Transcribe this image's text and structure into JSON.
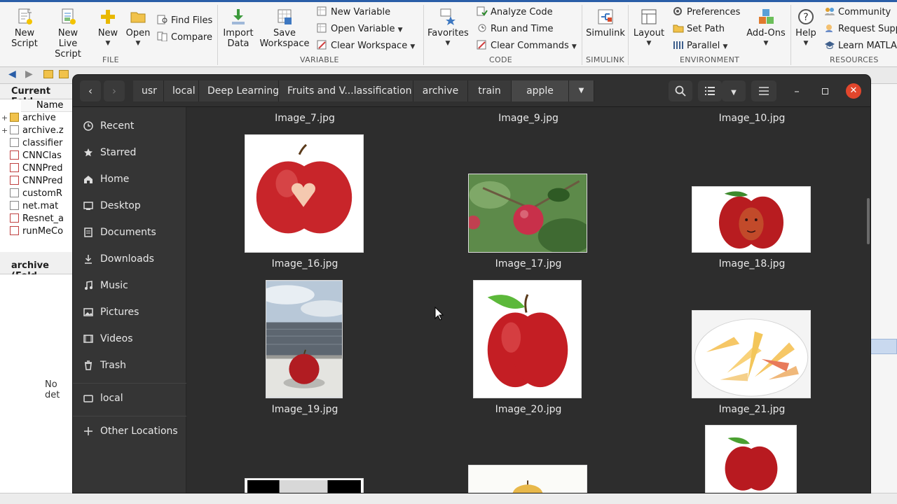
{
  "toolstrip": {
    "file": {
      "new_script": "New\nScript",
      "new_live_script": "New\nLive Script",
      "new": "New",
      "open": "Open",
      "find_files": "Find Files",
      "compare": "Compare",
      "section": "FILE"
    },
    "variable": {
      "import_data": "Import\nData",
      "save_workspace": "Save\nWorkspace",
      "new_variable": "New Variable",
      "open_variable": "Open Variable",
      "clear_workspace": "Clear Workspace",
      "section": "VARIABLE"
    },
    "code": {
      "favorites": "Favorites",
      "analyze_code": "Analyze Code",
      "run_and_time": "Run and Time",
      "clear_commands": "Clear Commands",
      "section": "CODE"
    },
    "simulink": {
      "label": "Simulink",
      "section": "SIMULINK"
    },
    "environment": {
      "layout": "Layout",
      "preferences": "Preferences",
      "set_path": "Set Path",
      "parallel": "Parallel",
      "add_ons": "Add-Ons",
      "section": "ENVIRONMENT"
    },
    "resources": {
      "help": "Help",
      "community": "Community",
      "request_support": "Request Supp",
      "learn_matlab": "Learn MATLAB",
      "section": "RESOURCES"
    }
  },
  "current_folder": {
    "title": "Current Fold",
    "column_name": "Name",
    "items": [
      {
        "name": "archive",
        "icon": "folder-icon"
      },
      {
        "name": "archive.z",
        "icon": "zip-file-icon"
      },
      {
        "name": "classifier",
        "icon": "file-icon"
      },
      {
        "name": "CNNClas",
        "icon": "mlx-file-icon"
      },
      {
        "name": "CNNPred",
        "icon": "mlx-file-icon"
      },
      {
        "name": "CNNPred",
        "icon": "mlx-file-icon"
      },
      {
        "name": "customR",
        "icon": "m-file-icon"
      },
      {
        "name": "net.mat",
        "icon": "mat-file-icon"
      },
      {
        "name": "Resnet_a",
        "icon": "mlx-file-icon"
      },
      {
        "name": "runMeCo",
        "icon": "mlx-file-icon"
      }
    ],
    "details_title": "archive  (Fold",
    "details_text": "No det"
  },
  "file_manager": {
    "breadcrumbs": [
      "usr",
      "local",
      "Deep Learning",
      "Fruits and V...lassification",
      "archive",
      "train",
      "apple"
    ],
    "sidebar": [
      {
        "label": "Recent",
        "icon": "clock-icon"
      },
      {
        "label": "Starred",
        "icon": "star-icon"
      },
      {
        "label": "Home",
        "icon": "home-icon"
      },
      {
        "label": "Desktop",
        "icon": "desktop-icon"
      },
      {
        "label": "Documents",
        "icon": "documents-icon"
      },
      {
        "label": "Downloads",
        "icon": "download-icon"
      },
      {
        "label": "Music",
        "icon": "music-icon"
      },
      {
        "label": "Pictures",
        "icon": "pictures-icon"
      },
      {
        "label": "Videos",
        "icon": "videos-icon"
      },
      {
        "label": "Trash",
        "icon": "trash-icon"
      },
      {
        "label": "local",
        "icon": "drive-icon"
      },
      {
        "label": "Other Locations",
        "icon": "plus-icon"
      }
    ],
    "files": [
      {
        "name": "Image_7.jpg"
      },
      {
        "name": "Image_9.jpg"
      },
      {
        "name": "Image_10.jpg"
      },
      {
        "name": "Image_16.jpg"
      },
      {
        "name": "Image_17.jpg"
      },
      {
        "name": "Image_18.jpg"
      },
      {
        "name": "Image_19.jpg"
      },
      {
        "name": "Image_20.jpg"
      },
      {
        "name": "Image_21.jpg"
      }
    ]
  }
}
